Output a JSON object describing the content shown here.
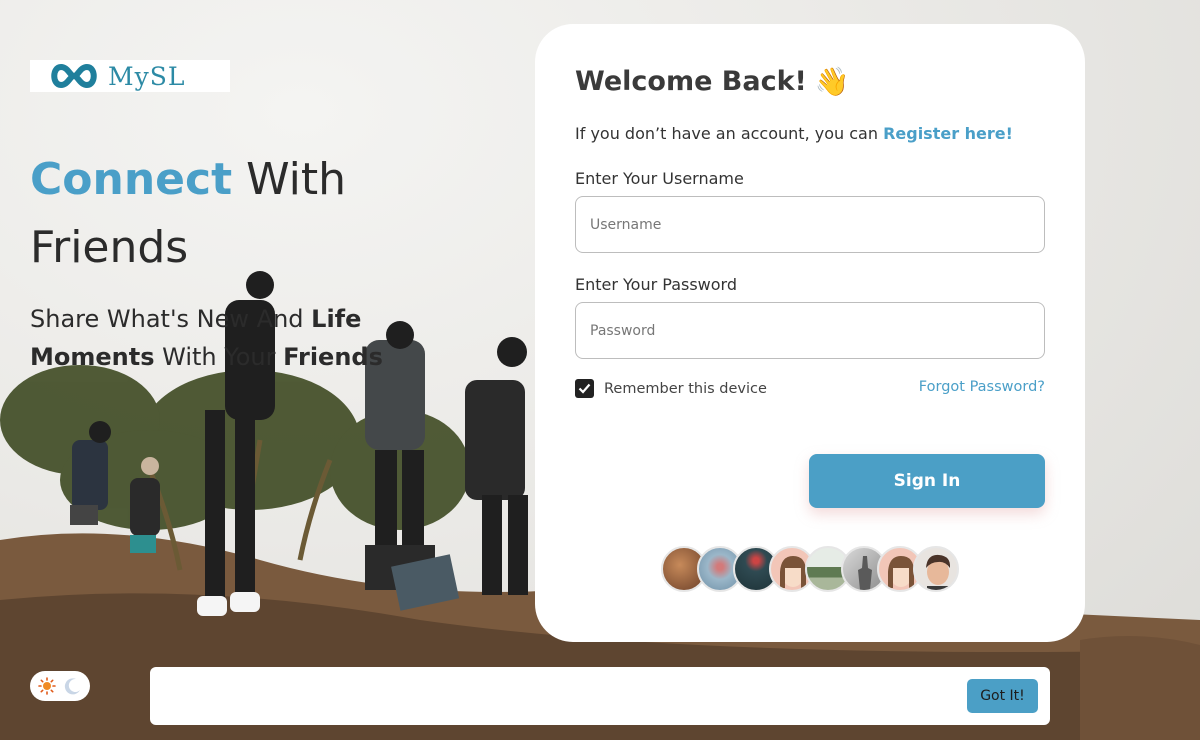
{
  "brand": {
    "name": "MySL"
  },
  "hero": {
    "title_accent": "Connect",
    "title_rest": " With Friends",
    "subtitle_part1": "Share What's New And ",
    "subtitle_bold1": "Life Moments",
    "subtitle_part2": " With Your ",
    "subtitle_bold2": "Friends"
  },
  "login": {
    "title": "Welcome Back!",
    "title_emoji": "👋",
    "register_prompt": "If you don’t have an account, you can ",
    "register_link": "Register here!",
    "username_label": "Enter Your Username",
    "username_placeholder": "Username",
    "password_label": "Enter Your Password",
    "password_placeholder": "Password",
    "remember_label": "Remember this device",
    "remember_checked": true,
    "forgot_link": "Forgot Password?",
    "signin_label": "Sign In"
  },
  "avatars": [
    {
      "name": "avatar-1",
      "color": "#8a5a3c"
    },
    {
      "name": "avatar-2",
      "color": "#9bb7c9"
    },
    {
      "name": "avatar-3",
      "color": "#2f4a52"
    },
    {
      "name": "avatar-4",
      "color": "#f2c6b8"
    },
    {
      "name": "avatar-5",
      "color": "#c9d3c2"
    },
    {
      "name": "avatar-6",
      "color": "#b8b8b8"
    },
    {
      "name": "avatar-7",
      "color": "#f2c6b8"
    },
    {
      "name": "avatar-8",
      "color": "#6b5a50"
    }
  ],
  "cookie_bar": {
    "button_label": "Got It!"
  },
  "theme_toggle": {
    "sun_icon": "sun-icon",
    "moon_icon": "moon-icon"
  },
  "colors": {
    "accent": "#4b9fc6",
    "text": "#2b2b2b"
  }
}
